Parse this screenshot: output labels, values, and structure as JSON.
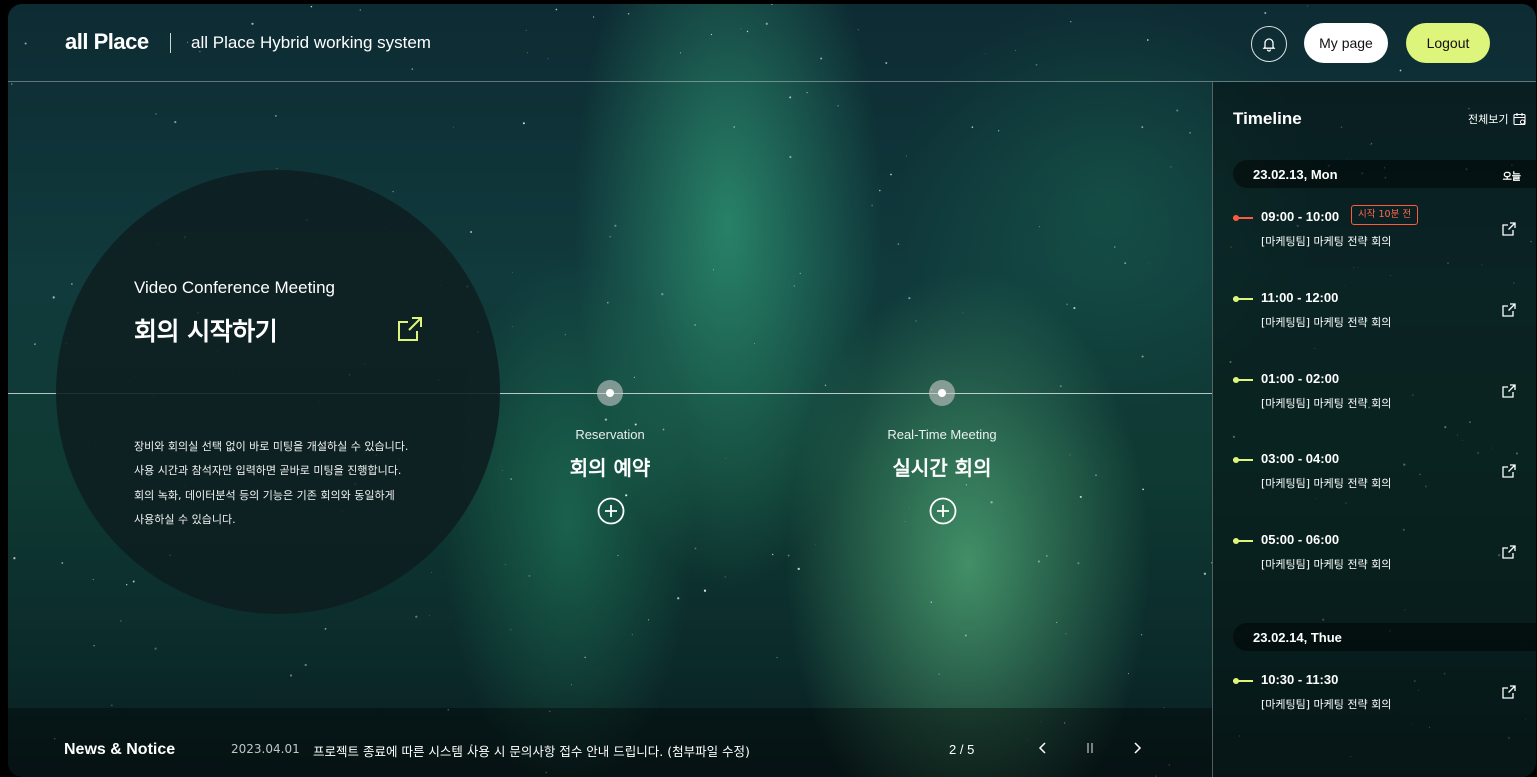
{
  "header": {
    "logo": "all Place",
    "subtitle": "all Place Hybrid working system",
    "mypage_label": "My page",
    "logout_label": "Logout"
  },
  "conference": {
    "title_en": "Video Conference Meeting",
    "title_ko": "회의 시작하기",
    "description": [
      "장비와 회의실 선택 없이 바로 미팅을 개설하실 수 있습니다.",
      "사용 시간과 참석자만 입력하면 곧바로 미팅을 진행합니다.",
      "회의 녹화, 데이터분석 등의 기능은 기존 회의와 동일하게",
      "사용하실 수 있습니다."
    ]
  },
  "options": [
    {
      "label_en": "Reservation",
      "label_ko": "회의 예약"
    },
    {
      "label_en": "Real-Time Meeting",
      "label_ko": "실시간 회의"
    }
  ],
  "news": {
    "title": "News & Notice",
    "date": "2023.04.01",
    "text": "프로젝트 종료에 따른 시스템 사용 시 문의사항 접수 안내 드립니다. (첨부파일 수정)",
    "page": "2 / 5"
  },
  "timeline": {
    "title": "Timeline",
    "view_all": "전체보기",
    "days": [
      {
        "date": "23.02.13, Mon",
        "tag": "오늘",
        "events": [
          {
            "time": "09:00 - 10:00",
            "title": "[마케팅팀] 마케팅 전략 회의",
            "badge": "시작 10분 전",
            "color": "#ff5a3c"
          },
          {
            "time": "11:00 - 12:00",
            "title": "[마케팅팀] 마케팅 전략 회의",
            "color": "#dcf57a"
          },
          {
            "time": "01:00 - 02:00",
            "title": "[마케팅팀] 마케팅 전략 회의",
            "color": "#dcf57a"
          },
          {
            "time": "03:00 - 04:00",
            "title": "[마케팅팀] 마케팅 전략 회의",
            "color": "#dcf57a"
          },
          {
            "time": "05:00 - 06:00",
            "title": "[마케팅팀] 마케팅 전략 회의",
            "color": "#dcf57a"
          }
        ]
      },
      {
        "date": "23.02.14, Thue",
        "events": [
          {
            "time": "10:30 - 11:30",
            "title": "[마케팅팀] 마케팅 전략 회의",
            "color": "#dcf57a"
          }
        ]
      }
    ]
  },
  "colors": {
    "accent": "#dcf57a",
    "alert": "#ff5a3c"
  }
}
